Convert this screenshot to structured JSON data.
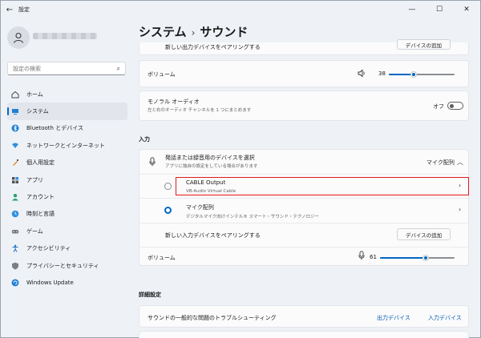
{
  "app": {
    "title": "設定"
  },
  "sidebar": {
    "search_placeholder": "設定の検索",
    "items": [
      {
        "label": "ホーム",
        "icon": "home-icon"
      },
      {
        "label": "システム",
        "icon": "system-icon"
      },
      {
        "label": "Bluetooth とデバイス",
        "icon": "bluetooth-icon"
      },
      {
        "label": "ネットワークとインターネット",
        "icon": "network-icon"
      },
      {
        "label": "個人用設定",
        "icon": "personalization-icon"
      },
      {
        "label": "アプリ",
        "icon": "apps-icon"
      },
      {
        "label": "アカウント",
        "icon": "account-icon"
      },
      {
        "label": "時刻と言語",
        "icon": "time-language-icon"
      },
      {
        "label": "ゲーム",
        "icon": "gaming-icon"
      },
      {
        "label": "アクセシビリティ",
        "icon": "accessibility-icon"
      },
      {
        "label": "プライバシーとセキュリティ",
        "icon": "privacy-icon"
      },
      {
        "label": "Windows Update",
        "icon": "windows-update-icon"
      }
    ],
    "active_index": 1
  },
  "header": {
    "crumb1": "システム",
    "sep": "›",
    "crumb2": "サウンド"
  },
  "output": {
    "pair_label": "新しい出力デバイスをペアリングする",
    "add_device": "デバイスの追加",
    "volume_label": "ボリューム",
    "volume_value": "38",
    "volume_level": 38,
    "mono_title": "モノラル オーディオ",
    "mono_sub": "左と右のオーディオ チャンネルを 1 つにまとめます",
    "mono_state": "オフ"
  },
  "input": {
    "section": "入力",
    "choose_title": "発話または録音用のデバイスを選択",
    "choose_sub": "アプリに独自の設定をしている場合があります",
    "selected": "マイク配列",
    "devices": [
      {
        "name": "CABLE Output",
        "desc": "VB-Audio Virtual Cable",
        "selected": false
      },
      {
        "name": "マイク配列",
        "desc": "デジタルマイク向けインテル® スマート・サウンド・テクノロジー",
        "selected": true
      }
    ],
    "pair_label": "新しい入力デバイスをペアリングする",
    "add_device": "デバイスの追加",
    "volume_label": "ボリューム",
    "volume_value": "61",
    "volume_level": 61
  },
  "advanced": {
    "section": "詳細設定",
    "troubleshoot": "サウンドの一般的な問題のトラブルシューティング",
    "output_link": "出力デバイス",
    "input_link": "入力デバイス"
  }
}
